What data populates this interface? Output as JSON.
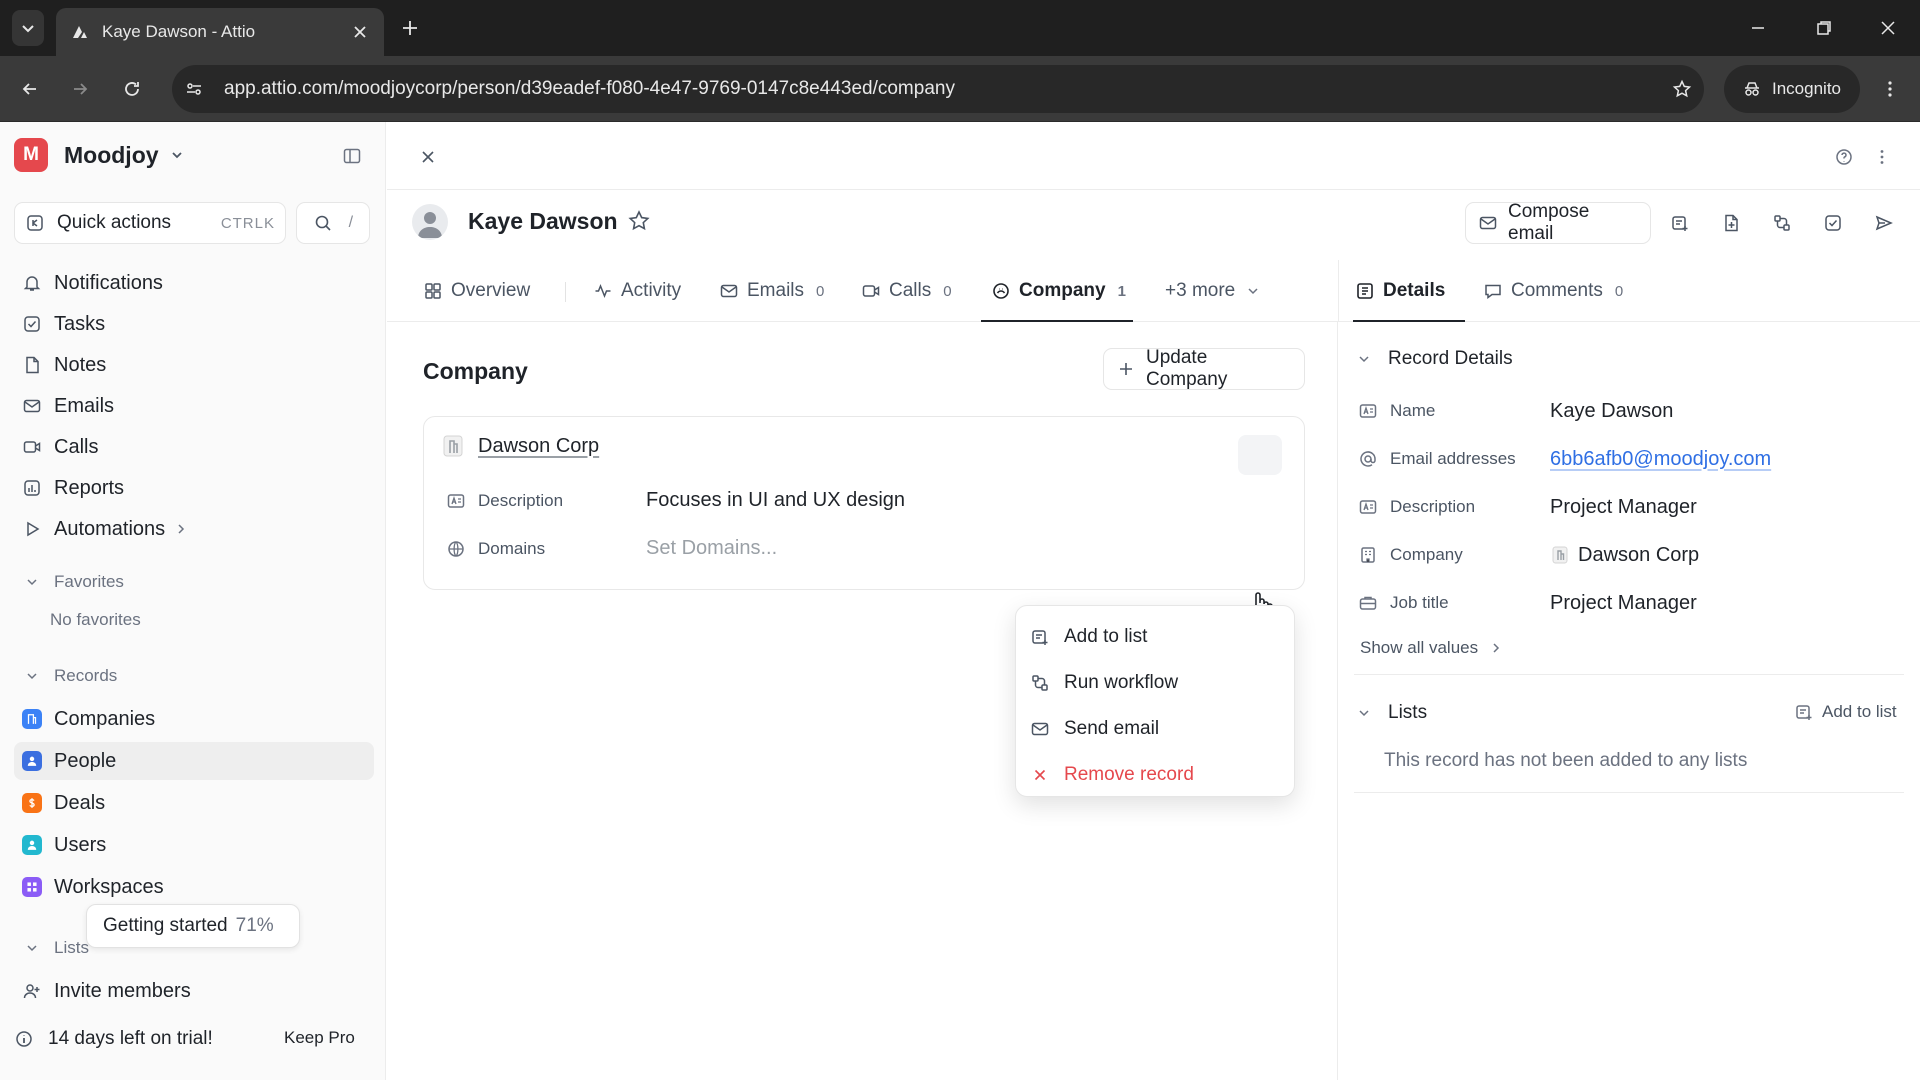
{
  "browser": {
    "tab_title": "Kaye Dawson - Attio",
    "url": "app.attio.com/moodjoycorp/person/d39eadef-f080-4e47-9769-0147c8e443ed/company",
    "incognito_label": "Incognito"
  },
  "workspace": {
    "logo_letter": "M",
    "name": "Moodjoy",
    "logo_color": "#e5484d"
  },
  "sidebar": {
    "quick_actions": "Quick actions",
    "quick_actions_shortcut": "CTRLK",
    "search_shortcut": "/",
    "nav": [
      {
        "label": "Notifications"
      },
      {
        "label": "Tasks"
      },
      {
        "label": "Notes"
      },
      {
        "label": "Emails"
      },
      {
        "label": "Calls"
      },
      {
        "label": "Reports"
      },
      {
        "label": "Automations"
      }
    ],
    "favorites_label": "Favorites",
    "no_favorites": "No favorites",
    "records_label": "Records",
    "records": [
      {
        "label": "Companies",
        "color": "#3b82f6"
      },
      {
        "label": "People",
        "color": "#3b6fe0"
      },
      {
        "label": "Deals",
        "color": "#f97316"
      },
      {
        "label": "Users",
        "color": "#22b8cf"
      },
      {
        "label": "Workspaces",
        "color": "#8b5cf6"
      }
    ],
    "lists_label": "Lists",
    "getting_started": "Getting started",
    "getting_started_pct": "71%",
    "invite_members": "Invite members",
    "trial_text": "14 days left on trial!",
    "keep_pro": "Keep Pro"
  },
  "record": {
    "name": "Kaye Dawson",
    "compose_email": "Compose email"
  },
  "tabs": [
    {
      "label": "Overview",
      "count": ""
    },
    {
      "label": "Activity",
      "count": ""
    },
    {
      "label": "Emails",
      "count": "0"
    },
    {
      "label": "Calls",
      "count": "0"
    },
    {
      "label": "Company",
      "count": "1"
    },
    {
      "label": "+3 more",
      "count": ""
    }
  ],
  "right_tabs": [
    {
      "label": "Details",
      "count": ""
    },
    {
      "label": "Comments",
      "count": "0"
    }
  ],
  "company_panel": {
    "title": "Company",
    "update_button": "Update Company",
    "card": {
      "name": "Dawson Corp",
      "rows": [
        {
          "key": "Description",
          "value": "Focuses in UI and UX design"
        },
        {
          "key": "Domains",
          "value": "Set Domains..."
        }
      ]
    }
  },
  "dropdown": [
    {
      "label": "Add to list"
    },
    {
      "label": "Run workflow"
    },
    {
      "label": "Send email"
    },
    {
      "label": "Remove record"
    }
  ],
  "details": {
    "section_title": "Record Details",
    "rows": [
      {
        "key": "Name",
        "value": "Kaye Dawson"
      },
      {
        "key": "Email addresses",
        "value": "6bb6afb0@moodjoy.com"
      },
      {
        "key": "Description",
        "value": "Project Manager"
      },
      {
        "key": "Company",
        "value": "Dawson Corp"
      },
      {
        "key": "Job title",
        "value": "Project Manager"
      }
    ],
    "show_all": "Show all values",
    "lists_title": "Lists",
    "add_to_list": "Add to list",
    "lists_empty": "This record has not been added to any lists"
  }
}
